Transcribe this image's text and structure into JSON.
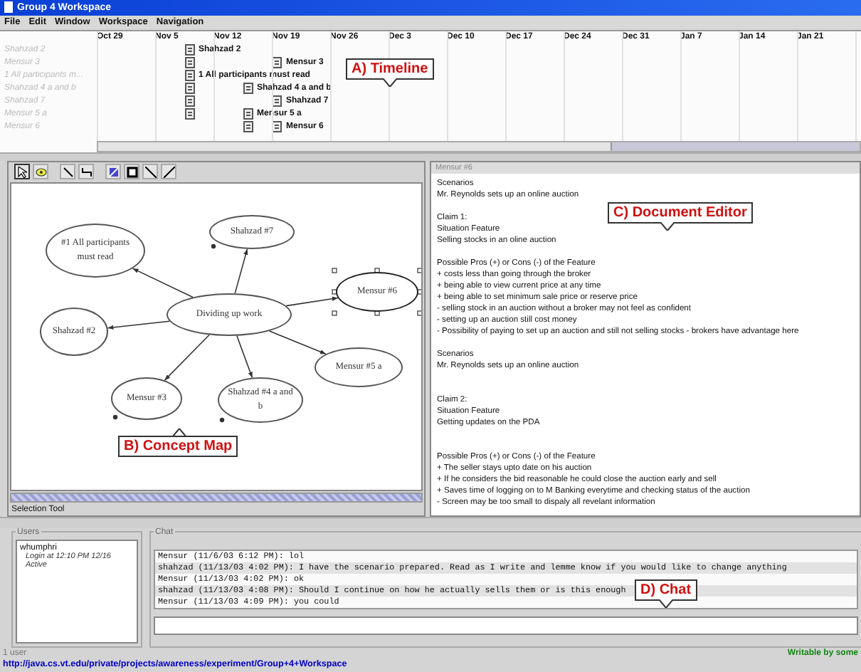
{
  "window": {
    "title": "Group 4 Workspace"
  },
  "menu": [
    "File",
    "Edit",
    "Window",
    "Workspace",
    "Navigation"
  ],
  "timeline": {
    "dates": [
      "Oct 29",
      "Nov 5",
      "Nov 12",
      "Nov 19",
      "Nov 26",
      "Dec 3",
      "Dec 10",
      "Dec 17",
      "Dec 24",
      "Dec 31",
      "Jan 7",
      "Jan 14",
      "Jan 21"
    ],
    "rows": [
      {
        "name": "Shahzad  2",
        "events": [
          {
            "kind": "entry",
            "label": "Shahzad  2"
          }
        ]
      },
      {
        "name": "Mensur  3",
        "events": [
          {
            "kind": "icon"
          },
          {
            "kind": "entry",
            "label": "Mensur  3"
          }
        ]
      },
      {
        "name": "1 All participants m...",
        "events": [
          {
            "kind": "entry",
            "label": "1 All participants must read"
          }
        ]
      },
      {
        "name": "Shahzad  4 a and b",
        "events": [
          {
            "kind": "icon"
          },
          {
            "kind": "entry",
            "label": "Shahzad  4 a and b"
          }
        ]
      },
      {
        "name": "Shahzad  7",
        "events": [
          {
            "kind": "icon"
          },
          {
            "kind": "entry",
            "label": "Shahzad  7"
          }
        ]
      },
      {
        "name": "Mensur  5 a",
        "events": [
          {
            "kind": "icon"
          },
          {
            "kind": "entry",
            "label": "Mensur  5 a"
          }
        ]
      },
      {
        "name": "Mensur  6",
        "events": [
          {
            "kind": "icon"
          },
          {
            "kind": "entry",
            "label": "Mensur  6"
          }
        ]
      }
    ],
    "callout": "A) Timeline"
  },
  "concept_map": {
    "nodes": [
      {
        "label": "#1 All participants must read",
        "selected": false,
        "anchor": false
      },
      {
        "label": "Shahzad #7",
        "selected": false,
        "anchor": true
      },
      {
        "label": "Mensur #6",
        "selected": true,
        "anchor": false
      },
      {
        "label": "Dividing up work",
        "selected": false,
        "anchor": false
      },
      {
        "label": "Shahzad #2",
        "selected": false,
        "anchor": false
      },
      {
        "label": "Mensur #5 a",
        "selected": false,
        "anchor": false
      },
      {
        "label": "Mensur #3",
        "selected": false,
        "anchor": true
      },
      {
        "label": "Shahzad #4 a and b",
        "selected": false,
        "anchor": true
      }
    ],
    "callout": "B) Concept Map",
    "status": "Selection Tool"
  },
  "document": {
    "title": "Mensur #6",
    "blocks": [
      [
        "Scenarios",
        "Mr. Reynolds sets up an online auction"
      ],
      [
        "Claim  1:",
        "Situation Feature",
        "Selling stocks in an oline auction"
      ],
      [
        "Possible Pros (+) or Cons (-) of the Feature",
        "+ costs less than going through the broker",
        "+ being able to view current price at any time",
        "+ being able to set minimum sale price or reserve price",
        "- selling stock in an auction without a broker may not feel as confident",
        "- setting up an auction still cost money",
        "- Possibility of paying to set up an auction and still not selling stocks - brokers have advantage here"
      ],
      [
        "Scenarios",
        "Mr. Reynolds sets up an online auction"
      ],
      [
        "Claim 2:",
        "Situation Feature",
        "Getting updates on the PDA"
      ],
      [
        "Possible Pros (+) or Cons (-) of the Feature",
        "+ The seller stays upto date on his auction",
        "+ If he considers the bid reasonable he could close the auction early and sell",
        "+ Saves time of logging on to M Banking everytime and checking status of the auction",
        "- Screen may be too small to dispaly all revelant information"
      ]
    ],
    "callout": "C) Document Editor"
  },
  "users": {
    "title": "Users",
    "list": [
      {
        "name": "whumphri",
        "login": "Login at 12:10 PM 12/16",
        "status": "Active"
      }
    ]
  },
  "chat": {
    "title": "Chat",
    "messages": [
      {
        "author": "Mensur",
        "time": "(11/6/03 6:12 PM):",
        "text": "lol"
      },
      {
        "author": "shahzad",
        "time": "(11/13/03 4:02 PM):",
        "text": "I have the scenario prepared. Read as I write and lemme know if you would like to change anything"
      },
      {
        "author": "Mensur",
        "time": "(11/13/03 4:02 PM):",
        "text": "ok"
      },
      {
        "author": "shahzad",
        "time": "(11/13/03 4:08 PM):",
        "text": "Should I continue on how he actually sells them or is this enough"
      },
      {
        "author": "Mensur",
        "time": "(11/13/03 4:09 PM):",
        "text": "you could"
      }
    ],
    "callout": "D) Chat"
  },
  "status_bar": {
    "users": "1 user",
    "access": "Writable by some"
  },
  "url": "http://java.cs.vt.edu/private/projects/awareness/experiment/Group+4+Workspace"
}
